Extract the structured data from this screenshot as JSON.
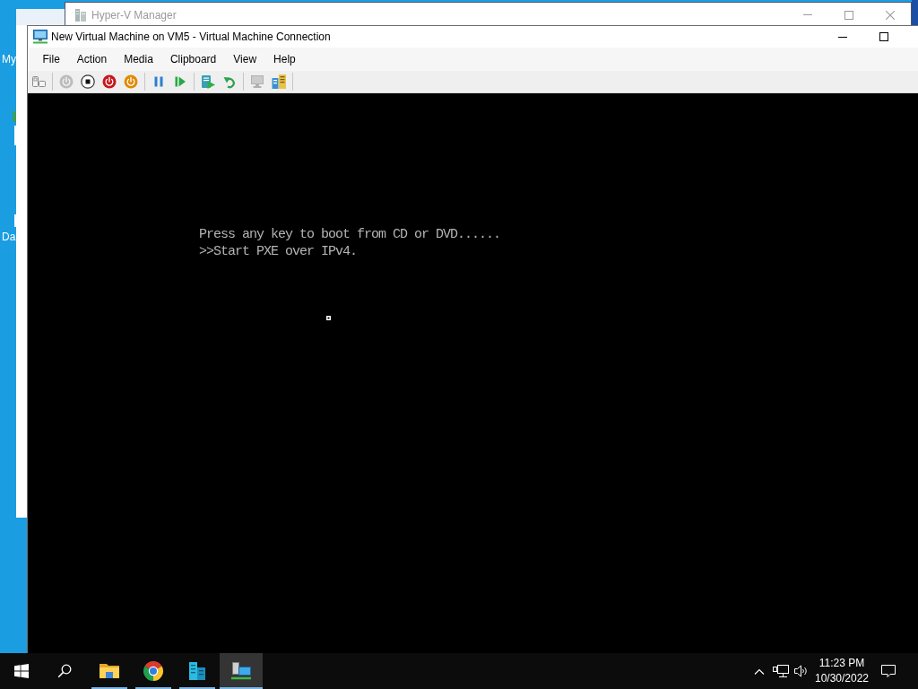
{
  "desktop": {
    "icons": [
      {
        "label": "My"
      },
      {
        "label": "Da"
      }
    ]
  },
  "background_window": {
    "title": "Hyper-V Manager"
  },
  "window": {
    "title": "New Virtual Machine on VM5 - Virtual Machine Connection",
    "menu": [
      "File",
      "Action",
      "Media",
      "Clipboard",
      "View",
      "Help"
    ],
    "toolbar": [
      {
        "kind": "ctrl-alt-del",
        "disabled": false
      },
      {
        "kind": "separator"
      },
      {
        "kind": "start",
        "disabled": true
      },
      {
        "kind": "turn-off",
        "disabled": false
      },
      {
        "kind": "shut-down",
        "disabled": false
      },
      {
        "kind": "save",
        "disabled": false
      },
      {
        "kind": "separator"
      },
      {
        "kind": "pause",
        "disabled": false
      },
      {
        "kind": "reset",
        "disabled": false
      },
      {
        "kind": "separator"
      },
      {
        "kind": "checkpoint",
        "disabled": false
      },
      {
        "kind": "revert",
        "disabled": false
      },
      {
        "kind": "separator"
      },
      {
        "kind": "enhanced-session",
        "disabled": true
      },
      {
        "kind": "zoom",
        "disabled": false
      },
      {
        "kind": "separator"
      }
    ],
    "console": {
      "lines": [
        "Press any key to boot from CD or DVD......",
        ">>Start PXE over IPv4."
      ]
    }
  },
  "taskbar": {
    "apps": [
      {
        "kind": "file-explorer",
        "open": true,
        "selected": false
      },
      {
        "kind": "browser",
        "open": true,
        "selected": false
      },
      {
        "kind": "hyperv-manager",
        "open": true,
        "selected": false
      },
      {
        "kind": "vm-connection",
        "open": true,
        "selected": true
      }
    ],
    "clock": {
      "time": "11:23 PM",
      "date": "10/30/2022"
    }
  }
}
